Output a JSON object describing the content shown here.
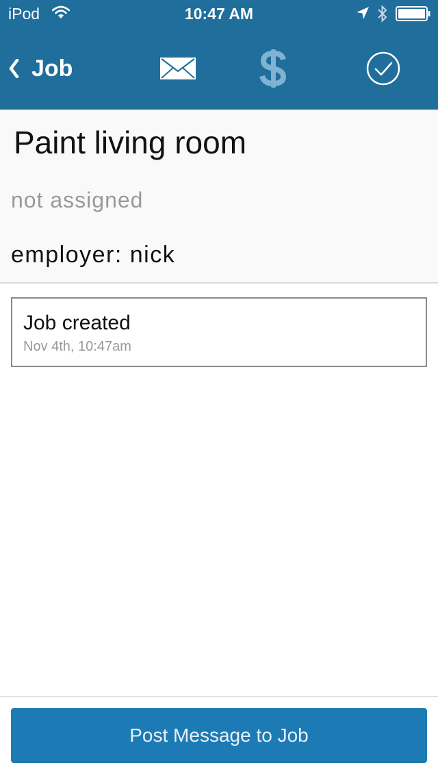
{
  "status_bar": {
    "carrier": "iPod",
    "time": "10:47 AM",
    "icons": [
      "wifi-icon",
      "location-arrow-icon",
      "bluetooth-icon",
      "battery-icon"
    ]
  },
  "nav": {
    "back_label": "Job",
    "icons": [
      "back-chevron-icon",
      "mail-icon",
      "dollar-icon",
      "check-circle-icon"
    ]
  },
  "job": {
    "title": "Paint living room",
    "assignee": "not assigned",
    "employer": "employer: nick"
  },
  "activity": [
    {
      "title": "Job created",
      "time": "Nov 4th, 10:47am"
    }
  ],
  "post_button_label": "Post Message to Job",
  "colors": {
    "header_bg": "#1f6e9c",
    "button_bg": "#1c7bb5",
    "dollar_icon": "#7fb2d3",
    "muted_text": "#999999"
  }
}
